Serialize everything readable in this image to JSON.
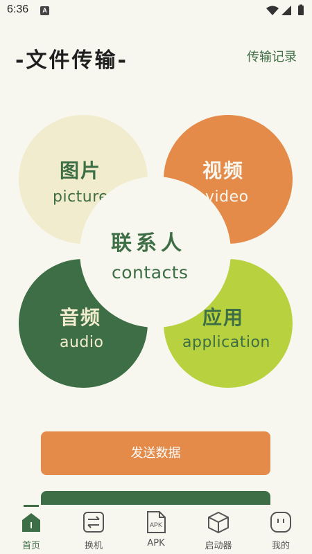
{
  "status_bar": {
    "time": "6:36",
    "notification_letter": "A",
    "icons": [
      "wifi-icon",
      "signal-icon",
      "battery-icon"
    ]
  },
  "header": {
    "title": "-文件传输-",
    "history_link": "传输记录"
  },
  "categories": {
    "picture": {
      "cn": "图片",
      "en": "picture"
    },
    "video": {
      "cn": "视频",
      "en": "video"
    },
    "audio": {
      "cn": "音频",
      "en": "audio"
    },
    "application": {
      "cn": "应用",
      "en": "application"
    },
    "contacts": {
      "cn": "联系人",
      "en": "contacts"
    }
  },
  "actions": {
    "send_label": "发送数据"
  },
  "bottom_nav": {
    "items": [
      {
        "label": "首页",
        "icon": "home-icon",
        "active": true
      },
      {
        "label": "换机",
        "icon": "swap-icon",
        "active": false
      },
      {
        "label": "APK",
        "icon": "apk-file-icon",
        "active": false,
        "icon_text": "APK"
      },
      {
        "label": "启动器",
        "icon": "cube-icon",
        "active": false
      },
      {
        "label": "我的",
        "icon": "profile-icon",
        "active": false
      }
    ]
  },
  "colors": {
    "background": "#F8F7EF",
    "primary_green": "#3E6E45",
    "orange": "#E58B49",
    "cream": "#F1ECCD",
    "lime": "#B8D23F"
  }
}
